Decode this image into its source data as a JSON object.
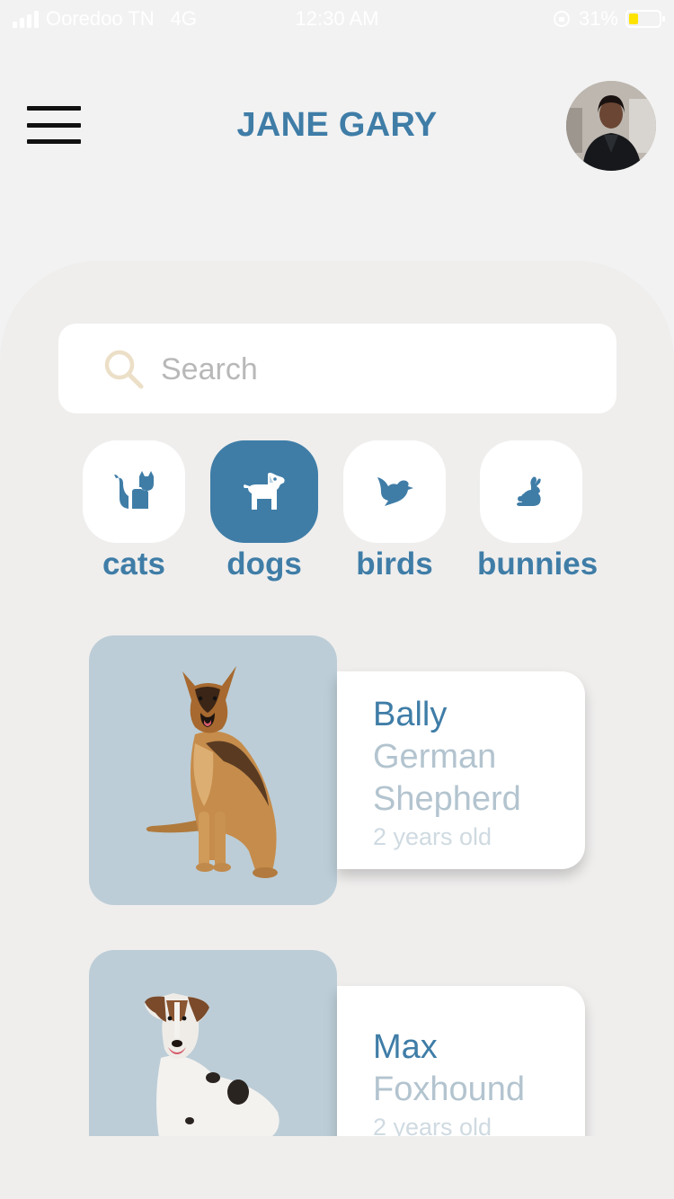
{
  "status_bar": {
    "carrier": "Ooredoo TN",
    "network": "4G",
    "time": "12:30 AM",
    "battery": "31%",
    "battery_level": 0.31
  },
  "header": {
    "title": "JANE GARY",
    "menu_icon": "hamburger-menu-icon",
    "avatar_icon": "user-avatar"
  },
  "search": {
    "placeholder": "Search",
    "icon": "search-icon"
  },
  "categories": [
    {
      "label": "cats",
      "icon": "cat-icon",
      "active": false
    },
    {
      "label": "dogs",
      "icon": "dog-icon",
      "active": true
    },
    {
      "label": "birds",
      "icon": "bird-icon",
      "active": false
    },
    {
      "label": "bunnies",
      "icon": "bunny-icon",
      "active": false
    }
  ],
  "pets": [
    {
      "name": "Bally",
      "breed_line1": "German",
      "breed_line2": "Shepherd",
      "age": "2 years old"
    },
    {
      "name": "Max",
      "breed_line1": "Foxhound",
      "age": "2 years old"
    }
  ],
  "colors": {
    "accent": "#3f7da7",
    "photo_bg": "#bccdd7",
    "muted_text": "#b3c4cf",
    "background": "#efeeed",
    "search_icon": "#e8dcc4"
  }
}
